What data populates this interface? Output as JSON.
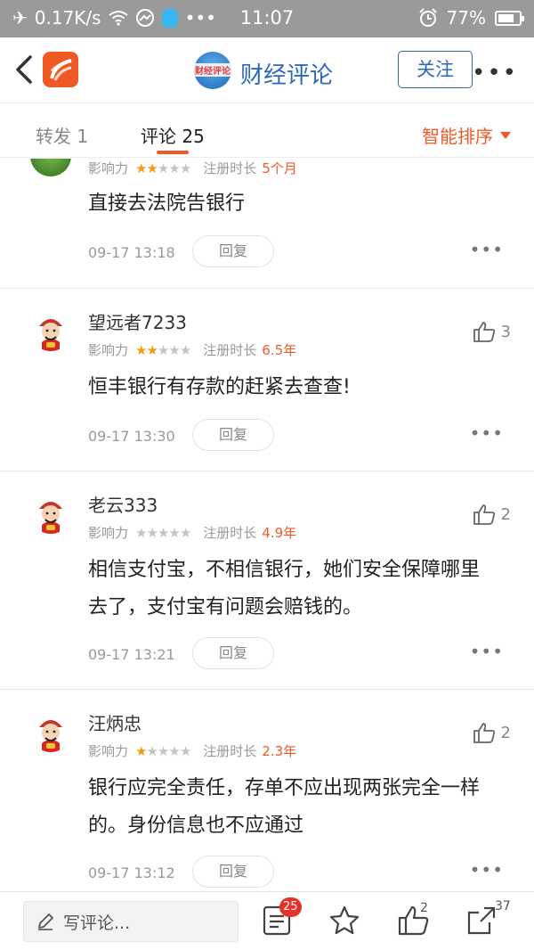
{
  "status_bar": {
    "speed": "0.17K/s",
    "time": "11:07",
    "battery": "77%",
    "battery_level": 0.77,
    "dots": "•••"
  },
  "header": {
    "channel_name": "财经评论",
    "avatar_text": "财经评论",
    "follow_label": "关注",
    "more": "•••"
  },
  "tabs": {
    "repost": "转发 1",
    "comments": "评论 25",
    "sort_label": "智能排序"
  },
  "comments": [
    {
      "name": "",
      "influence_label": "影响力",
      "stars": 2,
      "reg_label": "注册时长",
      "reg_value": "5个月",
      "text": "直接去法院告银行",
      "time": "09-17 13:18",
      "reply": "回复",
      "likes": ""
    },
    {
      "name": "望远者7233",
      "influence_label": "影响力",
      "stars": 2,
      "reg_label": "注册时长",
      "reg_value": "6.5年",
      "text": "恒丰银行有存款的赶紧去查查!",
      "time": "09-17 13:30",
      "reply": "回复",
      "likes": "3"
    },
    {
      "name": "老云333",
      "influence_label": "影响力",
      "stars": 0,
      "reg_label": "注册时长",
      "reg_value": "4.9年",
      "text": "相信支付宝，不相信银行，她们安全保障哪里去了，支付宝有问题会赔钱的。",
      "time": "09-17 13:21",
      "reply": "回复",
      "likes": "2"
    },
    {
      "name": "汪炳忠",
      "influence_label": "影响力",
      "stars": 1,
      "reg_label": "注册时长",
      "reg_value": "2.3年",
      "text": "银行应完全责任，存单不应出现两张完全一样的。身份信息也不应通过",
      "time": "09-17 13:12",
      "reply": "回复",
      "likes": "2"
    }
  ],
  "bottom_bar": {
    "write_placeholder": "写评论...",
    "comment_count": "25",
    "like_count": "2",
    "share_count": "37"
  },
  "colors": {
    "accent": "#f05a28",
    "brand_blue": "#2d69b8",
    "star_on": "#f39c12"
  }
}
